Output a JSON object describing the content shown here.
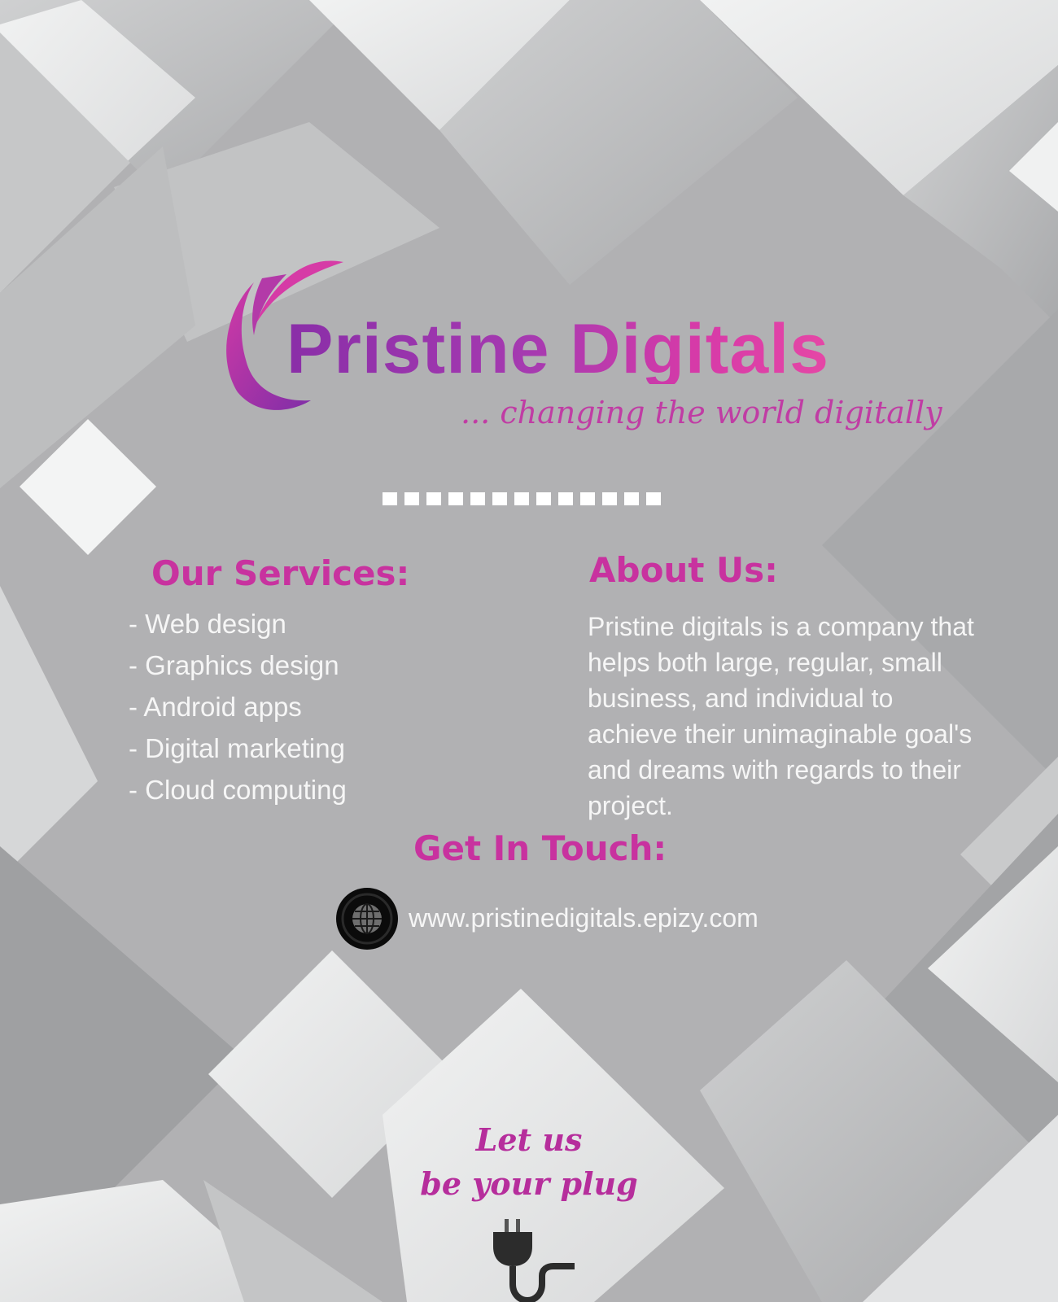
{
  "brand": {
    "name": "Pristine Digitals",
    "tagline": "... changing the world digitally",
    "logo_icon": "crescent-swoosh-logo",
    "colors": {
      "accent_purple": "#8a2ea8",
      "accent_magenta": "#e547a6"
    }
  },
  "divider": {
    "icon": "dotted-divider",
    "dot_count": 13
  },
  "services": {
    "heading": "Our Services:",
    "items": [
      "- Web design",
      "- Graphics design",
      "- Android apps",
      "- Digital marketing",
      "- Cloud computing"
    ]
  },
  "about": {
    "heading": "About Us:",
    "text": "Pristine digitals is a company that helps both large, regular, small business, and individual to achieve their unimaginable goal's and dreams with regards  to their project."
  },
  "contact": {
    "heading": "Get In Touch:",
    "website": "www.pristinedigitals.epizy.com",
    "icon": "globe-icon"
  },
  "slogan": {
    "line1": "Let us",
    "line2": "be your plug",
    "icon": "plug-icon"
  }
}
